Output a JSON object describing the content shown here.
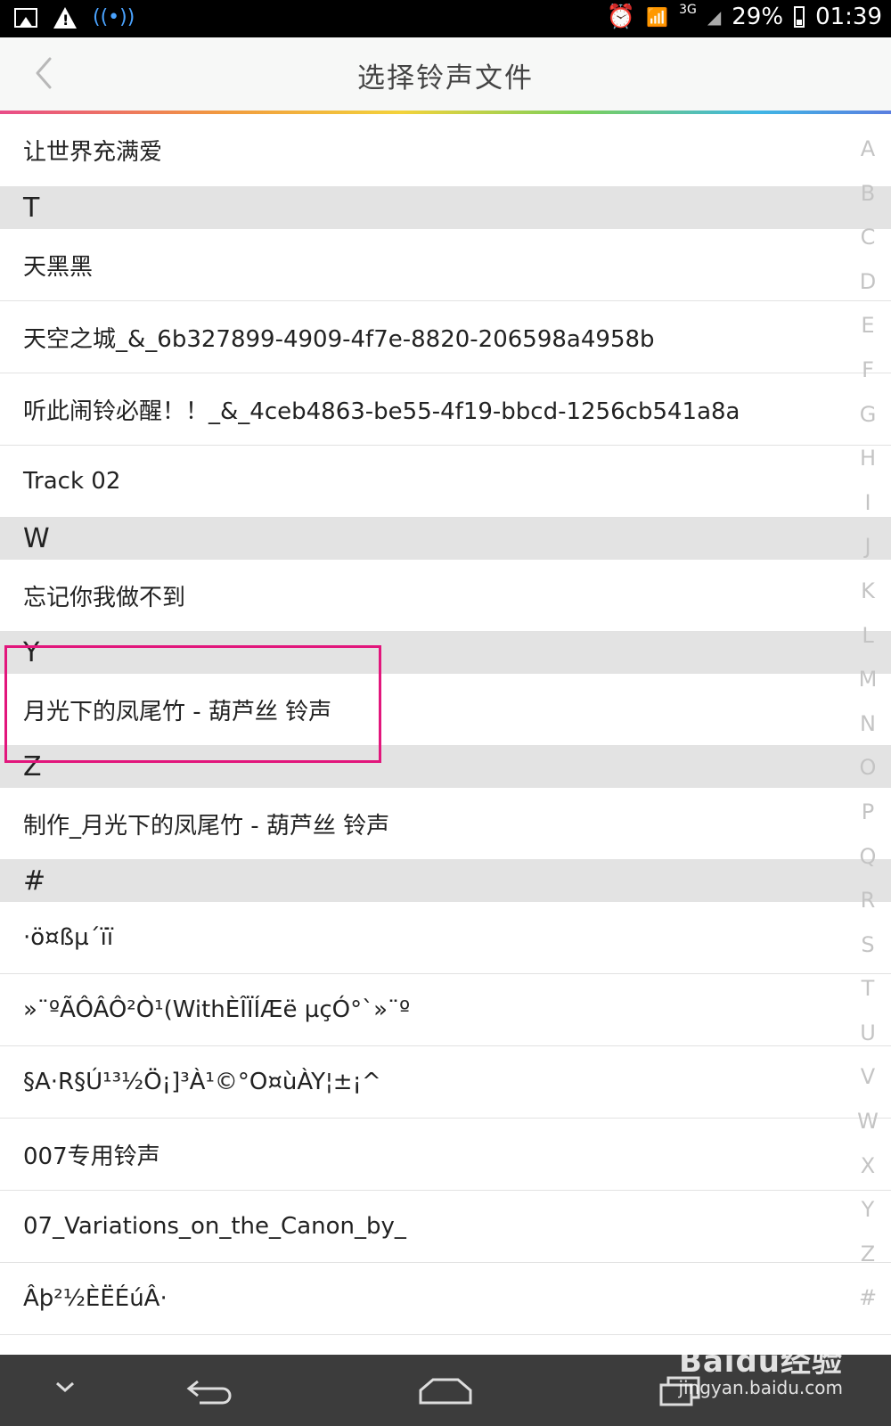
{
  "status_bar": {
    "network": "3G",
    "battery": "29%",
    "time": "01:39"
  },
  "title_bar": {
    "title": "选择铃声文件"
  },
  "list": [
    {
      "type": "row",
      "text": "让世界充满爱"
    },
    {
      "type": "header",
      "text": "T"
    },
    {
      "type": "row",
      "text": "天黑黑"
    },
    {
      "type": "row",
      "text": "天空之城_&_6b327899-4909-4f7e-8820-206598a4958b"
    },
    {
      "type": "row",
      "text": "听此闹铃必醒！！_&_4ceb4863-be55-4f19-bbcd-1256cb541a8a"
    },
    {
      "type": "row",
      "text": "Track 02"
    },
    {
      "type": "header",
      "text": "W"
    },
    {
      "type": "row",
      "text": "忘记你我做不到"
    },
    {
      "type": "header",
      "text": "Y"
    },
    {
      "type": "row",
      "text": "月光下的凤尾竹 - 葫芦丝 铃声"
    },
    {
      "type": "header",
      "text": "Z"
    },
    {
      "type": "row",
      "text": "制作_月光下的凤尾竹 - 葫芦丝 铃声"
    },
    {
      "type": "header",
      "text": "#"
    },
    {
      "type": "row",
      "text": "·ö¤ßµ´ïï"
    },
    {
      "type": "row",
      "text": "»¨ºÃÔÂÔ²Ò¹(WithÈÎÏÍÆë µçÓ°`»¨º"
    },
    {
      "type": "row",
      "text": "§A·R§Ú¹³½Ö¡]³À¹©°O¤ùÀY¦±¡^"
    },
    {
      "type": "row",
      "text": "007专用铃声"
    },
    {
      "type": "row",
      "text": "07_Variations_on_the_Canon_by_"
    },
    {
      "type": "row",
      "text": "Âþ²½ÈËÉúÂ·"
    }
  ],
  "index_letters": [
    "A",
    "B",
    "C",
    "D",
    "E",
    "F",
    "G",
    "H",
    "I",
    "J",
    "K",
    "L",
    "M",
    "N",
    "O",
    "P",
    "Q",
    "R",
    "S",
    "T",
    "U",
    "V",
    "W",
    "X",
    "Y",
    "Z",
    "#"
  ],
  "watermark": {
    "logo": "Baidu经验",
    "url": "jingyan.baidu.com"
  },
  "colors": {
    "highlight": "#e2167c",
    "header_bg": "#e3e3e3",
    "nav_bg": "#3c3c3c"
  }
}
